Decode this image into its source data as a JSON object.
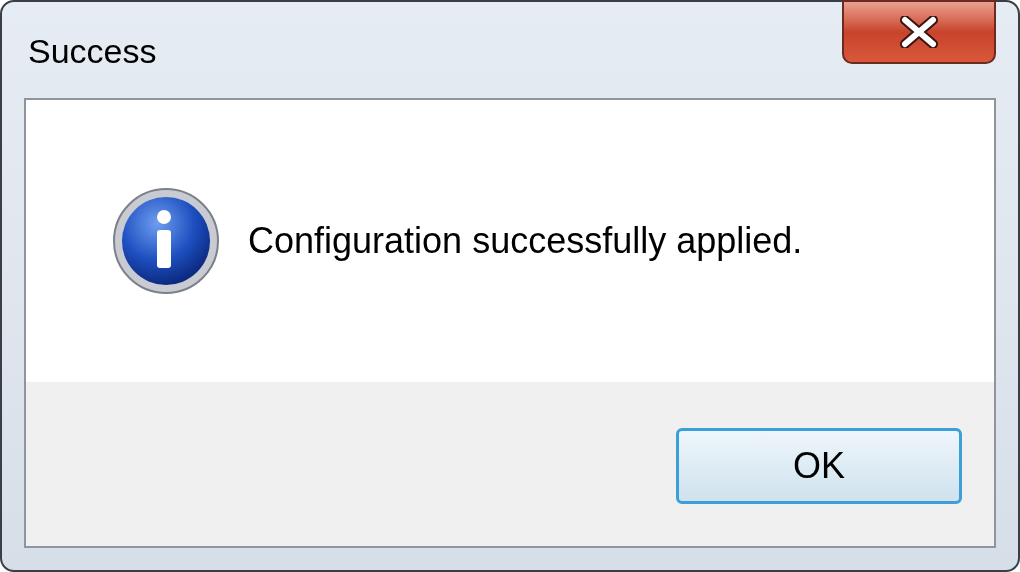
{
  "window": {
    "title": "Success"
  },
  "message": "Configuration successfully applied.",
  "buttons": [
    {
      "label": "OK",
      "default": true
    }
  ]
}
